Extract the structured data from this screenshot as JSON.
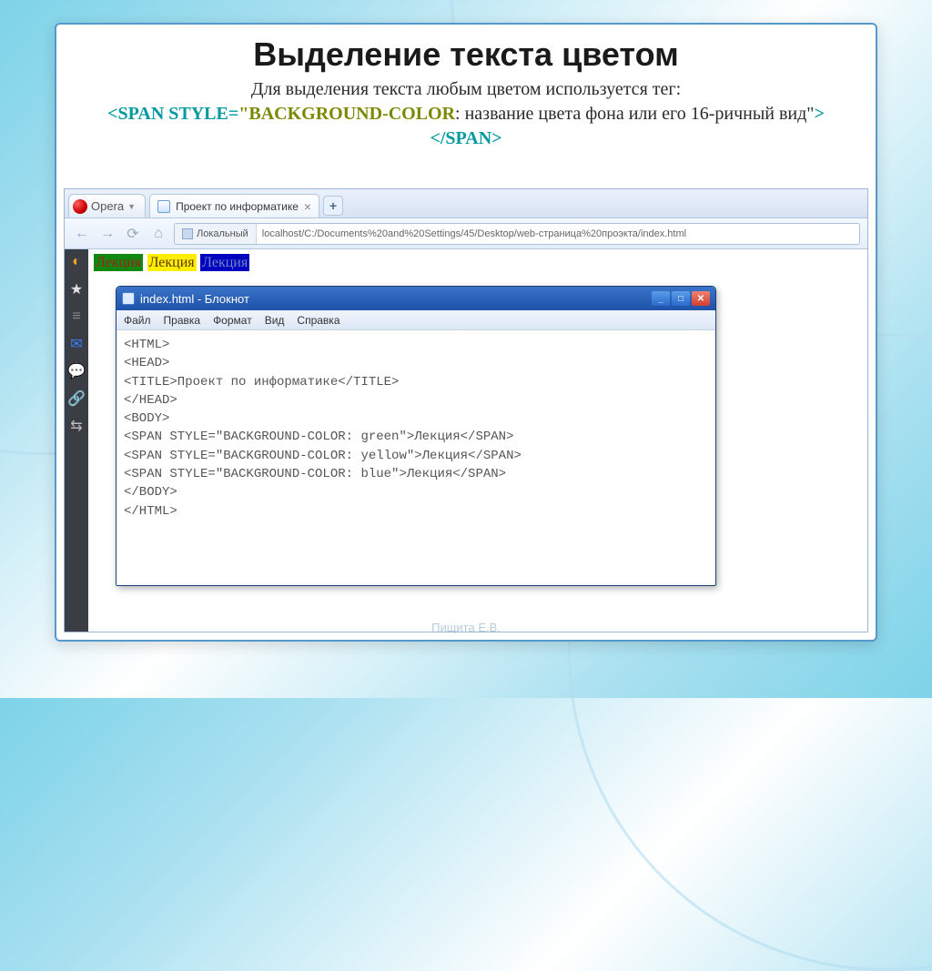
{
  "slide": {
    "title": "Выделение текста цветом",
    "subtitle_pre": "Для выделения текста любым цветом используется тег:",
    "tag_open_1": "<SPAN STYLE=",
    "tag_open_2": "\"BACKGROUND-COLOR",
    "subtitle_post": ": название цвета фона или его 16-ричный вид\"",
    "tag_close": "></SPAN>",
    "footer": "Пищита Е.В."
  },
  "browser": {
    "app_button": "Opera",
    "tab_title": "Проект по информатике",
    "address_local": "Локальный",
    "address_path": "localhost/C:/Documents%20and%20Settings/45/Desktop/web-страница%20проэкта/index.html"
  },
  "highlights": [
    {
      "text": "Лекция",
      "class": "hl-green"
    },
    {
      "text": "Лекция",
      "class": "hl-yellow"
    },
    {
      "text": "Лекция",
      "class": "hl-blue"
    }
  ],
  "notepad": {
    "title": "index.html - Блокнот",
    "menu": [
      "Файл",
      "Правка",
      "Формат",
      "Вид",
      "Справка"
    ],
    "lines": [
      "<HTML>",
      "<HEAD>",
      "<TITLE>Проект по информатике</TITLE>",
      "</HEAD>",
      "<BODY>",
      "<SPAN STYLE=\"BACKGROUND-COLOR: green\">Лекция</SPAN>",
      "<SPAN STYLE=\"BACKGROUND-COLOR: yellow\">Лекция</SPAN>",
      "<SPAN STYLE=\"BACKGROUND-COLOR: blue\">Лекция</SPAN>",
      "</BODY>",
      "</HTML>"
    ]
  }
}
